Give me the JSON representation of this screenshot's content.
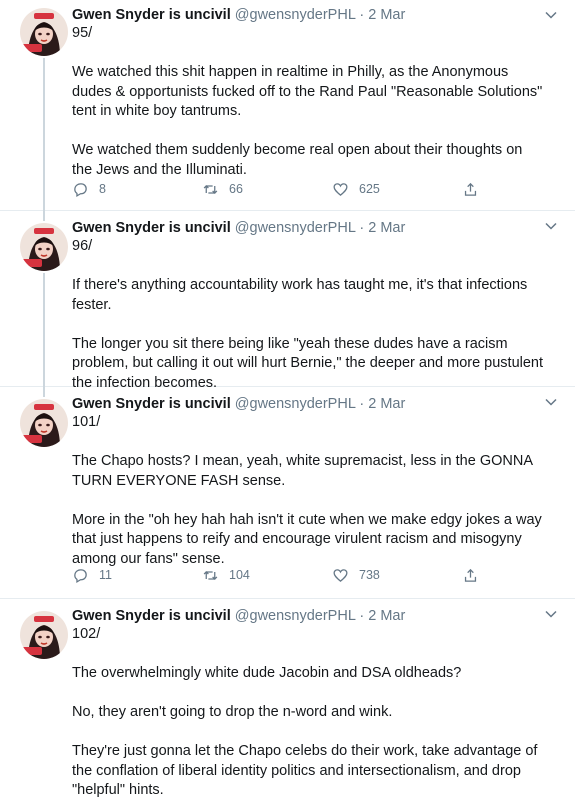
{
  "author": {
    "name": "Gwen Snyder is uncivil",
    "handle": "@gwensnyderPHL",
    "date": "2 Mar"
  },
  "tweets": [
    {
      "number": "95/",
      "paragraphs": [
        "We watched this shit happen in realtime in Philly, as the Anonymous dudes & opportunists fucked off to the Rand Paul \"Reasonable Solutions\" tent in white boy tantrums.",
        "We watched them suddenly become real open about their thoughts on the Jews and the Illuminati."
      ],
      "replies": "8",
      "retweets": "66",
      "likes": "625"
    },
    {
      "number": "96/",
      "paragraphs": [
        "If there's anything accountability work has taught me, it's that infections fester.",
        "The longer you sit there being like \"yeah these dudes have a racism problem, but calling it out will hurt Bernie,\" the deeper and more pustulent the infection becomes."
      ]
    },
    {
      "number": "101/",
      "paragraphs": [
        "The Chapo hosts? I mean, yeah, white supremacist, less in the GONNA TURN EVERYONE FASH sense.",
        "More in the \"oh hey hah hah isn't it cute when we make edgy jokes a way that just happens to reify and encourage virulent racism and misogyny among our fans\" sense."
      ],
      "replies": "11",
      "retweets": "104",
      "likes": "738"
    },
    {
      "number": "102/",
      "paragraphs": [
        "The overwhelmingly white dude Jacobin and DSA oldheads?",
        "No, they aren't going to drop the n-word and wink.",
        "They're just gonna let the Chapo celebs do their work, take advantage of the conflation of liberal identity politics and intersectionalism, and drop \"helpful\" hints."
      ]
    }
  ],
  "colors": {
    "text": "#14171a",
    "secondary": "#657786",
    "divider": "#e6ecf0",
    "thread": "#ccd6dd"
  },
  "icons": [
    "avatar",
    "chevron-down-icon",
    "reply-icon",
    "retweet-icon",
    "like-icon",
    "share-icon"
  ]
}
